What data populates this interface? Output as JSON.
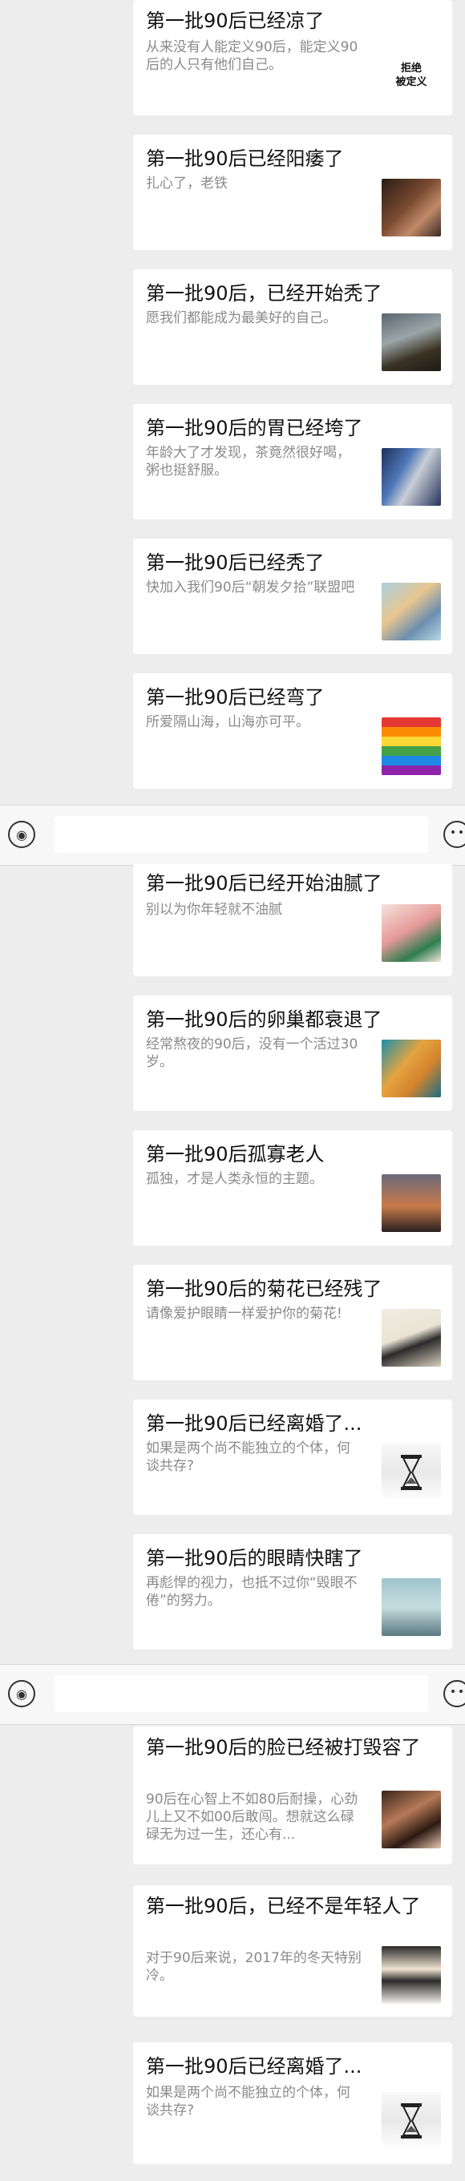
{
  "articles": [
    {
      "title": "第一批90后已经凉了",
      "desc": "从来没有人能定义90后，能定义90后的人只有他们自己。",
      "thumb_icon": "text-cover-icon",
      "thumb_text": "拒绝\n被定义"
    },
    {
      "title": "第一批90后已经阳痿了",
      "desc": "扎心了，老铁",
      "thumb_icon": "photo-thumbnail-icon"
    },
    {
      "title": "第一批90后，已经开始秃了",
      "desc": "愿我们都能成为最美好的自己。",
      "thumb_icon": "photo-thumbnail-icon"
    },
    {
      "title": "第一批90后的胃已经垮了",
      "desc": "年龄大了才发现，茶竟然很好喝，粥也挺舒服。",
      "thumb_icon": "illustration-thumbnail-icon"
    },
    {
      "title": "第一批90后已经秃了",
      "desc": "快加入我们90后“朝发夕拾”联盟吧",
      "thumb_icon": "cartoon-thumbnail-icon"
    },
    {
      "title": "第一批90后已经弯了",
      "desc": "所爱隔山海，山海亦可平。",
      "thumb_icon": "rainbow-flag-icon"
    },
    {
      "title": "第一批90后已经开始油腻了",
      "desc": "别以为你年轻就不油腻",
      "thumb_icon": "illustration-thumbnail-icon"
    },
    {
      "title": "第一批90后的卵巢都衰退了",
      "desc": "经常熬夜的90后，没有一个活过30岁。",
      "thumb_icon": "cartoon-thumbnail-icon"
    },
    {
      "title": "第一批90后孤寡老人",
      "desc": "孤独，才是人类永恒的主题。",
      "thumb_icon": "sunset-photo-icon"
    },
    {
      "title": "第一批90后的菊花已经残了",
      "desc": "请像爱护眼睛一样爱护你的菊花!",
      "thumb_icon": "illustration-thumbnail-icon"
    },
    {
      "title": "第一批90后已经离婚了...",
      "desc": "如果是两个尚不能独立的个体，何谈共存?",
      "thumb_icon": "hourglass-icon"
    },
    {
      "title": "第一批90后的眼睛快瞎了",
      "desc": "再彪悍的视力，也抵不过你“毁眼不倦”的努力。",
      "thumb_icon": "photo-thumbnail-icon"
    },
    {
      "title": "第一批90后的脸已经被打毁容了",
      "desc": "90后在心智上不如80后耐操，心劲儿上又不如00后敢闯。想就这么碌碌无为过一生，还心有...",
      "thumb_icon": "portrait-photo-icon"
    },
    {
      "title": "第一批90后，已经不是年轻人了",
      "desc": "对于90后来说，2017年的冬天特别冷。",
      "thumb_icon": "portrait-photo-icon"
    },
    {
      "title": "第一批90后已经离婚了...",
      "desc": "如果是两个尚不能独立的个体，何谈共存?",
      "thumb_icon": "hourglass-icon"
    }
  ],
  "input_bar": {
    "voice_icon": "voice-icon",
    "emoji_icon": "emoji-icon",
    "input_value": ""
  }
}
